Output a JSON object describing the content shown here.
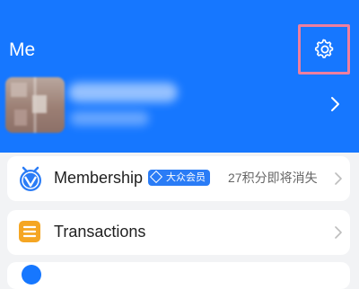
{
  "header": {
    "title": "Me",
    "settings_icon": "gear-icon",
    "background_color": "#1677ff",
    "highlight_color": "#ee7f9f"
  },
  "profile": {
    "avatar": "avatar (blurred)",
    "chevron_icon": "chevron-right-icon"
  },
  "menu": {
    "membership": {
      "icon": "membership-icon",
      "label": "Membership",
      "badge": "大众会员",
      "points_notice": "27积分即将消失"
    },
    "transactions": {
      "icon": "transactions-icon",
      "label": "Transactions"
    }
  },
  "colors": {
    "accent": "#1677ff",
    "transactions_icon": "#f5a623",
    "text_primary": "#1f1f1f",
    "text_secondary": "#666666"
  }
}
